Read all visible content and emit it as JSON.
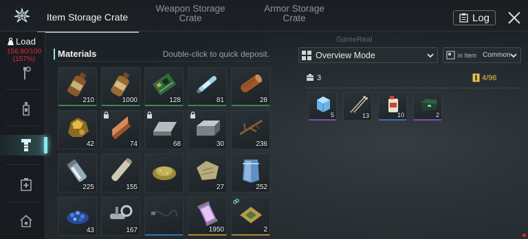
{
  "header": {
    "tabs": [
      {
        "label": "Item Storage Crate",
        "active": true
      },
      {
        "label": "Weapon Storage Crate",
        "active": false
      },
      {
        "label": "Armor Storage Crate",
        "active": false
      }
    ],
    "log_label": "Log"
  },
  "sidebar": {
    "load_label": "Load",
    "load_value": "156.90/100",
    "load_percent": "(157%)",
    "items": [
      {
        "icon": "tools-icon"
      },
      {
        "icon": "bottle-icon"
      },
      {
        "icon": "bolt-icon",
        "selected": true
      },
      {
        "icon": "medkit-icon"
      },
      {
        "icon": "house-icon"
      }
    ]
  },
  "materials": {
    "title": "Materials",
    "hint": "Double-click to quick deposit.",
    "items": [
      {
        "icon": "bottle-icon",
        "qty": "210"
      },
      {
        "icon": "bottle-icon",
        "qty": "1000"
      },
      {
        "icon": "circuit-board-icon",
        "qty": "128"
      },
      {
        "icon": "tube-icon",
        "qty": "81"
      },
      {
        "icon": "wood-log-icon",
        "qty": "28"
      },
      {
        "icon": "gold-ore-icon",
        "qty": "42"
      },
      {
        "icon": "copper-ingot-icon",
        "qty": "74",
        "locked": true
      },
      {
        "icon": "steel-plate-icon",
        "qty": "68",
        "locked": true
      },
      {
        "icon": "metal-block-icon",
        "qty": "30",
        "locked": true
      },
      {
        "icon": "branch-icon",
        "qty": "236"
      },
      {
        "icon": "glass-vial-icon",
        "qty": "225"
      },
      {
        "icon": "pipe-icon",
        "qty": "155"
      },
      {
        "icon": "sand-pile-icon",
        "qty": ""
      },
      {
        "icon": "cloth-icon",
        "qty": "27"
      },
      {
        "icon": "armor-plate-icon",
        "qty": "252"
      },
      {
        "icon": "blue-gems-icon",
        "qty": "43"
      },
      {
        "icon": "valve-icon",
        "qty": "167"
      },
      {
        "icon": "cable-icon",
        "qty": ""
      },
      {
        "icon": "energy-cell-icon",
        "qty": "1950"
      },
      {
        "icon": "chip-icon",
        "qty": "2",
        "linked": true
      }
    ]
  },
  "right_panel": {
    "watermark": "GameReal",
    "mode": "Overview Mode",
    "filter_sub": "in Item",
    "filter_value": "Common",
    "count": "3",
    "capacity": "4/96",
    "items": [
      {
        "icon": "ice-cube-icon",
        "qty": "5"
      },
      {
        "icon": "arrows-icon",
        "qty": "13"
      },
      {
        "icon": "fuel-canister-icon",
        "qty": "10"
      },
      {
        "icon": "green-case-icon",
        "qty": "2"
      }
    ]
  },
  "colors": {
    "accent": "#8ee6ec",
    "overload": "#e2263f",
    "capacity": "#e7c34b"
  }
}
